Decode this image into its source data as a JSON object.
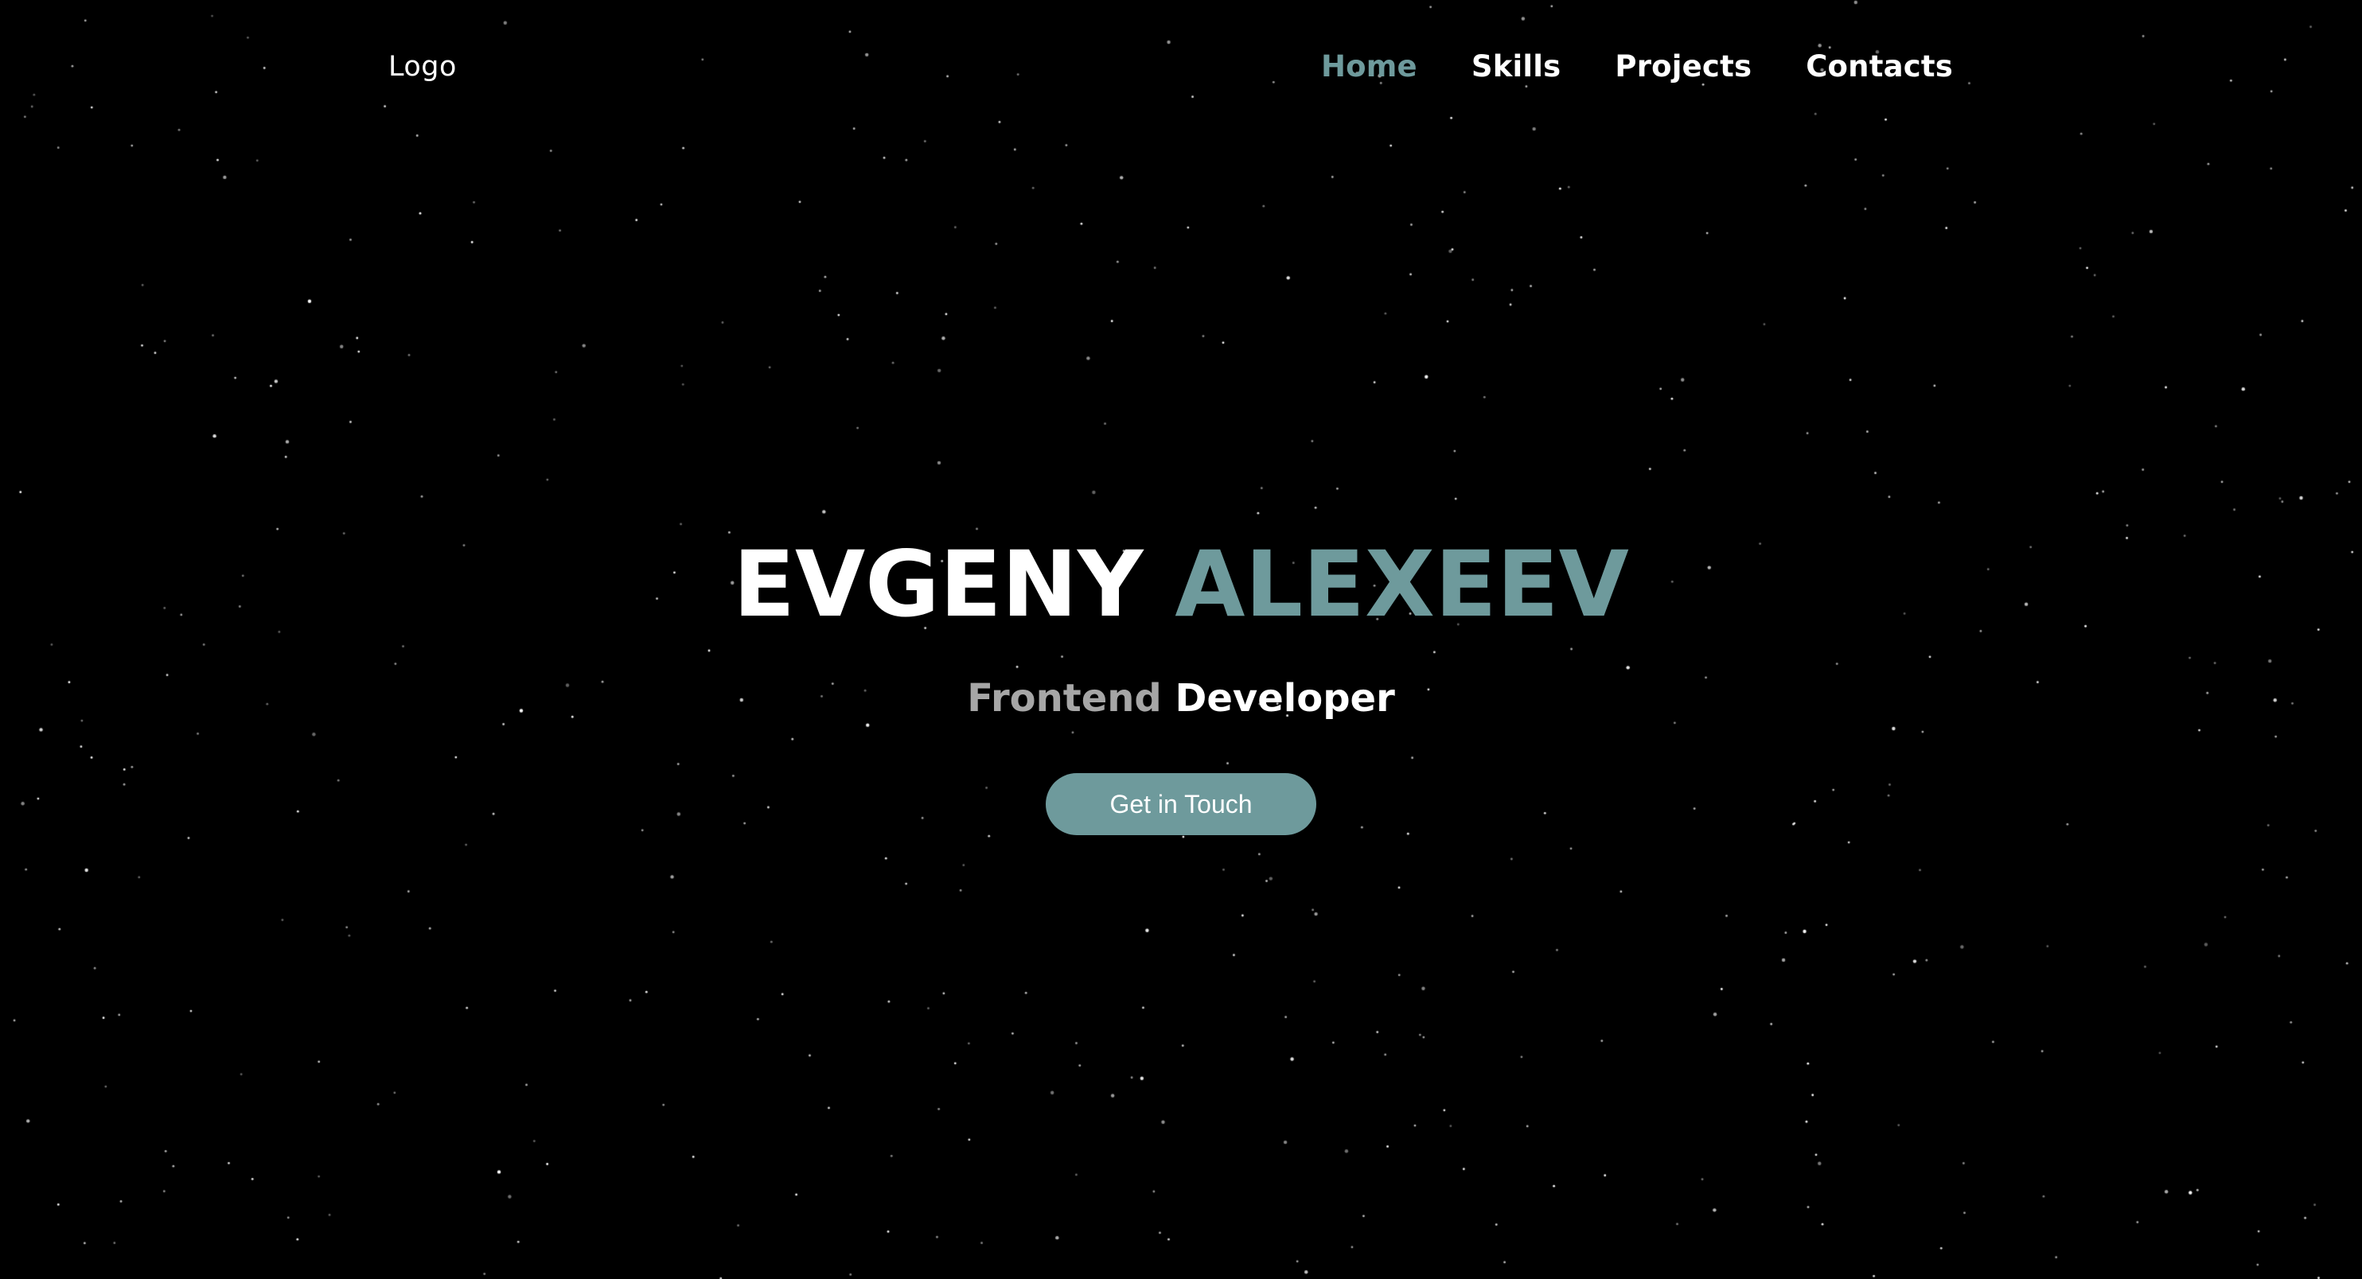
{
  "nav": {
    "logo": "Logo",
    "items": [
      {
        "label": "Home",
        "active": true
      },
      {
        "label": "Skills",
        "active": false
      },
      {
        "label": "Projects",
        "active": false
      },
      {
        "label": "Contacts",
        "active": false
      }
    ]
  },
  "hero": {
    "first_name": "EVGENY",
    "last_name": "ALEXEEV",
    "role_muted": "Frontend",
    "role_bright": "Developer",
    "cta_label": "Get in Touch"
  },
  "colors": {
    "background": "#000000",
    "accent": "#6e9a9c",
    "text": "#ffffff",
    "muted": "#a6a6a6"
  }
}
